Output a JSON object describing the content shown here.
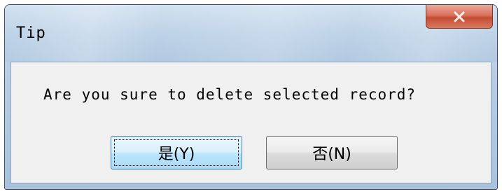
{
  "window": {
    "title": "Tip",
    "close_icon": "close-icon"
  },
  "message": "Are you sure to delete selected record?",
  "buttons": {
    "yes_label": "是(Y)",
    "no_label": "否(N)"
  },
  "colors": {
    "title_bar": "#bdd2e7",
    "client_area": "#f0f0f0",
    "close_button": "#c64a33",
    "default_button": "#bee6fd"
  }
}
